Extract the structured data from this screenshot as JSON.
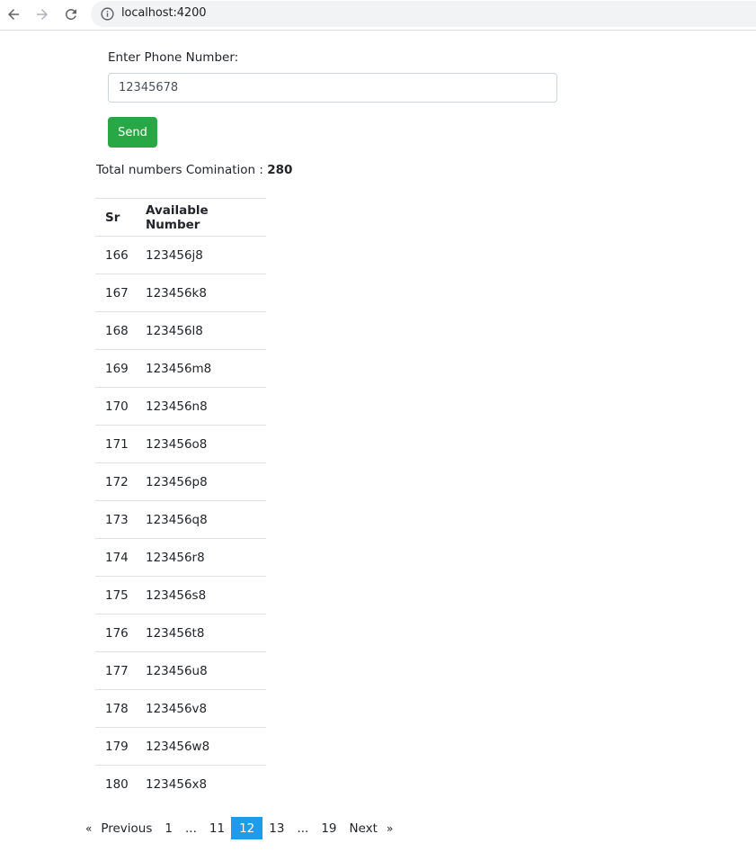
{
  "browser": {
    "url": "localhost:4200"
  },
  "form": {
    "label": "Enter Phone Number:",
    "phone_value": "12345678",
    "send_label": "Send"
  },
  "summary": {
    "prefix": "Total numbers Comination : ",
    "total": "280"
  },
  "table": {
    "headers": [
      "Sr",
      "Available Number"
    ],
    "rows": [
      [
        "166",
        "123456j8"
      ],
      [
        "167",
        "123456k8"
      ],
      [
        "168",
        "123456l8"
      ],
      [
        "169",
        "123456m8"
      ],
      [
        "170",
        "123456n8"
      ],
      [
        "171",
        "123456o8"
      ],
      [
        "172",
        "123456p8"
      ],
      [
        "173",
        "123456q8"
      ],
      [
        "174",
        "123456r8"
      ],
      [
        "175",
        "123456s8"
      ],
      [
        "176",
        "123456t8"
      ],
      [
        "177",
        "123456u8"
      ],
      [
        "178",
        "123456v8"
      ],
      [
        "179",
        "123456w8"
      ],
      [
        "180",
        "123456x8"
      ]
    ]
  },
  "pagination": {
    "previous_arrow": "«",
    "previous_label": "Previous",
    "pages": [
      "1",
      "...",
      "11",
      "12",
      "13",
      "...",
      "19"
    ],
    "current_page": "12",
    "next_label": "Next",
    "next_arrow": "»"
  },
  "colors": {
    "send_button": "#28a745",
    "current_page": "#1e9be9"
  }
}
